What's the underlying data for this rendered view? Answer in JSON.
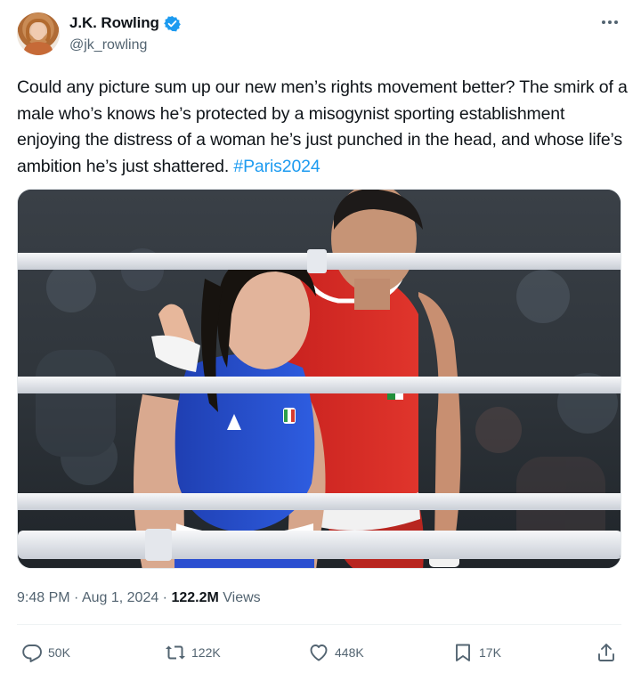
{
  "author": {
    "display_name": "J.K. Rowling",
    "handle": "@jk_rowling",
    "verified_icon": "verified-badge-icon",
    "verified_color": "#1d9bf0"
  },
  "tweet": {
    "text_body": "Could any picture sum up our new men’s rights movement better? The smirk of a male who’s knows he’s protected by a misogynist sporting establishment enjoying the distress of a woman he’s just punched in the head, and whose life’s ambition he’s just shattered. ",
    "hashtag": "#Paris2024",
    "hashtag_color": "#1d9bf0"
  },
  "meta": {
    "time": "9:48 PM",
    "sep1": " · ",
    "date": "Aug 1, 2024",
    "sep2": " · ",
    "views_count": "122.2M",
    "views_label": " Views"
  },
  "actions": {
    "reply_count": "50K",
    "repost_count": "122K",
    "like_count": "448K",
    "bookmark_count": "17K",
    "icons": [
      "reply-icon",
      "repost-icon",
      "like-icon",
      "bookmark-icon",
      "share-icon"
    ]
  },
  "colors": {
    "text": "#0f1419",
    "secondary": "#536471",
    "accent": "#1d9bf0",
    "divider": "#eff3f4"
  }
}
